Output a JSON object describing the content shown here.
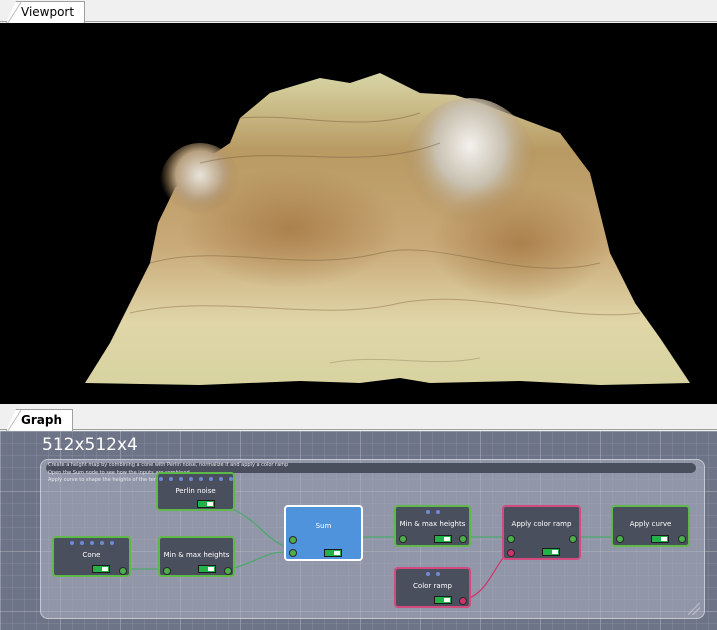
{
  "tabs": {
    "viewport": "Viewport",
    "graph": "Graph"
  },
  "graph": {
    "resolution": "512x512x4",
    "comments": [
      "Create a height map by combining a cone with Perlin noise, normalize it and apply a color ramp",
      "Open the Sum node to see how the inputs are combined",
      "Apply curve to shape the heights of the terrain and adjust the result"
    ],
    "nodes": [
      {
        "id": "perlin",
        "title": "Perlin noise"
      },
      {
        "id": "cone",
        "title": "Cone"
      },
      {
        "id": "minmax1",
        "title": "Min & max heights"
      },
      {
        "id": "sum",
        "title": "Sum"
      },
      {
        "id": "minmax2",
        "title": "Min & max heights"
      },
      {
        "id": "colorramp",
        "title": "Color ramp"
      },
      {
        "id": "applyramp",
        "title": "Apply color ramp"
      },
      {
        "id": "applycurve",
        "title": "Apply curve"
      }
    ]
  },
  "colors": {
    "node_border_green": "#5fb94a",
    "node_border_pink": "#d24a7e",
    "selected_node": "#4f93dd",
    "graph_bg": "#6e7487"
  }
}
